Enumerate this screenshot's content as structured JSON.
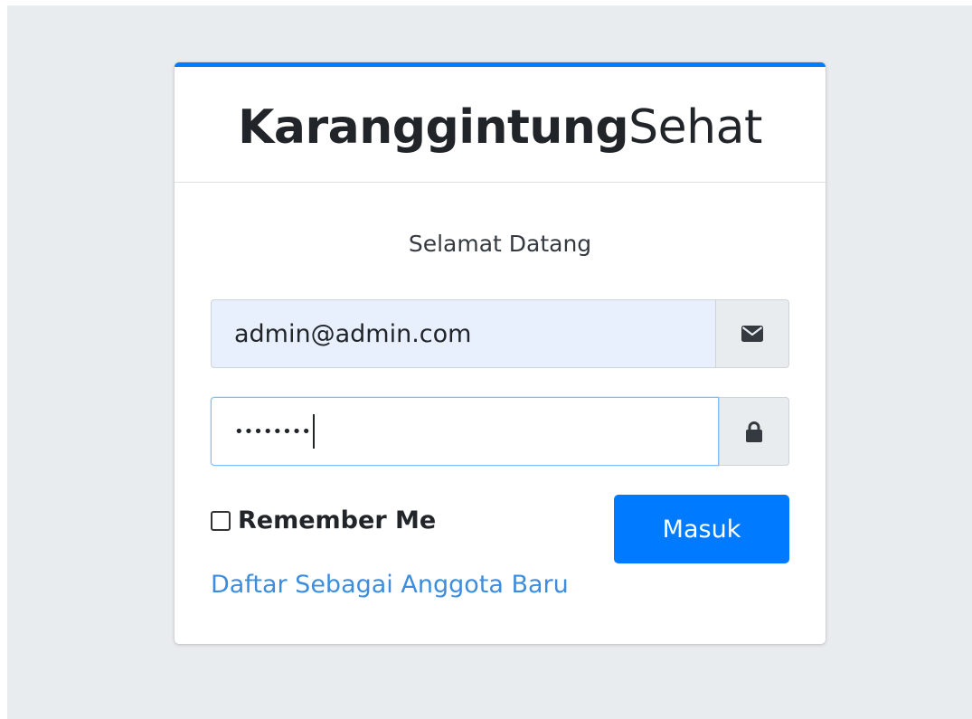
{
  "brand": {
    "bold": "Karanggintung",
    "light": "Sehat"
  },
  "welcome_text": "Selamat Datang",
  "email": {
    "value": "admin@admin.com",
    "icon": "envelope-icon"
  },
  "password": {
    "masked_value": "••••••••",
    "icon": "lock-icon"
  },
  "remember_label": "Remember Me",
  "submit_label": "Masuk",
  "register_link": "Daftar Sebagai Anggota Baru",
  "colors": {
    "primary": "#007bff",
    "background": "#e9ecef",
    "link": "#3c8dde",
    "autofill": "#e8f0fe"
  }
}
